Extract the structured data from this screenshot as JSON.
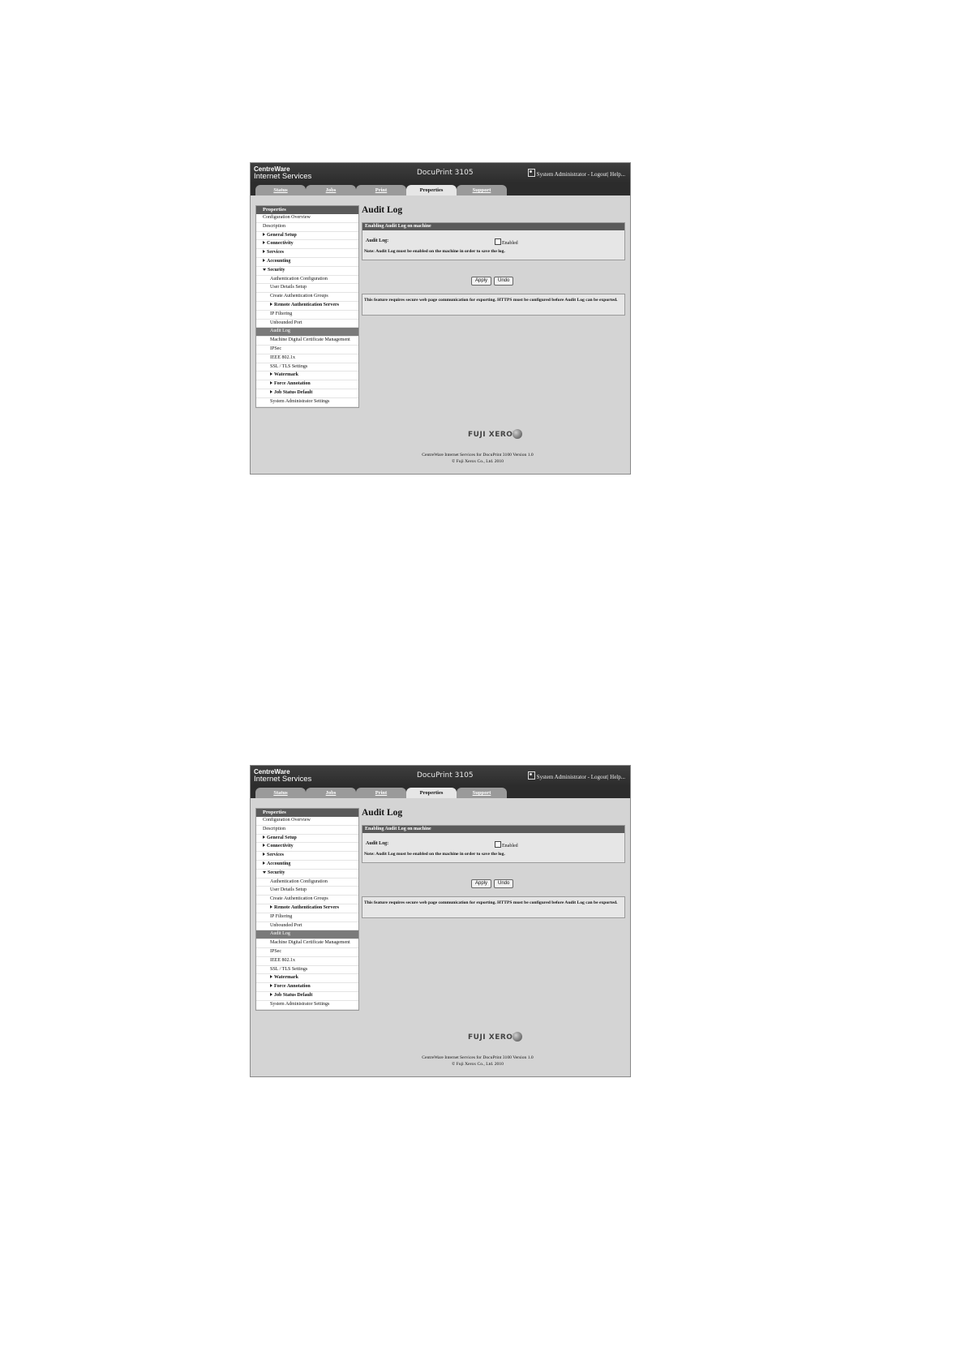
{
  "header": {
    "logo_line1": "CentreWare",
    "logo_line2": "Internet Services",
    "model": "DocuPrint 3105",
    "user": "System Administrator",
    "logout": " - Logout",
    "help": "| Help..."
  },
  "tabs": [
    "Status",
    "Jobs",
    "Print",
    "Properties",
    "Support"
  ],
  "active_tab": "Properties",
  "sidebar": {
    "heading": "Properties",
    "items": [
      {
        "label": "Configuration Overview",
        "level": 0,
        "expander": "none"
      },
      {
        "label": "Description",
        "level": 0,
        "expander": "none"
      },
      {
        "label": "General Setup",
        "level": 0,
        "expander": "collapsed"
      },
      {
        "label": "Connectivity",
        "level": 0,
        "expander": "collapsed"
      },
      {
        "label": "Services",
        "level": 0,
        "expander": "collapsed"
      },
      {
        "label": "Accounting",
        "level": 0,
        "expander": "collapsed"
      },
      {
        "label": "Security",
        "level": 0,
        "expander": "expanded"
      },
      {
        "label": "Authentication Configuration",
        "level": 1,
        "expander": "none"
      },
      {
        "label": "User Details Setup",
        "level": 1,
        "expander": "none"
      },
      {
        "label": "Create Authentication Groups",
        "level": 1,
        "expander": "none"
      },
      {
        "label": "Remote Authentication Servers",
        "level": 1,
        "expander": "collapsed"
      },
      {
        "label": "IP Filtering",
        "level": 1,
        "expander": "none"
      },
      {
        "label": "Unbounded Port",
        "level": 1,
        "expander": "none"
      },
      {
        "label": "Audit Log",
        "level": 1,
        "expander": "none",
        "selected": true
      },
      {
        "label": "Machine Digital Certificate Management",
        "level": 1,
        "expander": "none"
      },
      {
        "label": "IPSec",
        "level": 1,
        "expander": "none"
      },
      {
        "label": "IEEE 802.1x",
        "level": 1,
        "expander": "none"
      },
      {
        "label": "SSL / TLS Settings",
        "level": 1,
        "expander": "none"
      },
      {
        "label": "Watermark",
        "level": 1,
        "expander": "collapsed"
      },
      {
        "label": "Force Annotation",
        "level": 1,
        "expander": "collapsed"
      },
      {
        "label": "Job Status Default",
        "level": 1,
        "expander": "collapsed"
      },
      {
        "label": "System Administrator Settings",
        "level": 1,
        "expander": "none"
      }
    ]
  },
  "main": {
    "title": "Audit Log",
    "panel_heading": "Enabling Audit Log on machine",
    "audit_log_label": "Audit Log:",
    "enabled_label": "Enabled",
    "enabled_checked": false,
    "note": "Note: Audit Log must be enabled on the machine in order to save the log.",
    "apply": "Apply",
    "undo": "Undo",
    "info": "This feature requires secure web page communication for exporting. HTTPS must be configured before Audit Log can be exported."
  },
  "footer": {
    "brand": "FUJI XEROX",
    "line1": "CentreWare Internet Services for DocuPrint 3100 Version 1.0",
    "line2": "© Fuji Xerox Co., Ltd. 2010"
  }
}
